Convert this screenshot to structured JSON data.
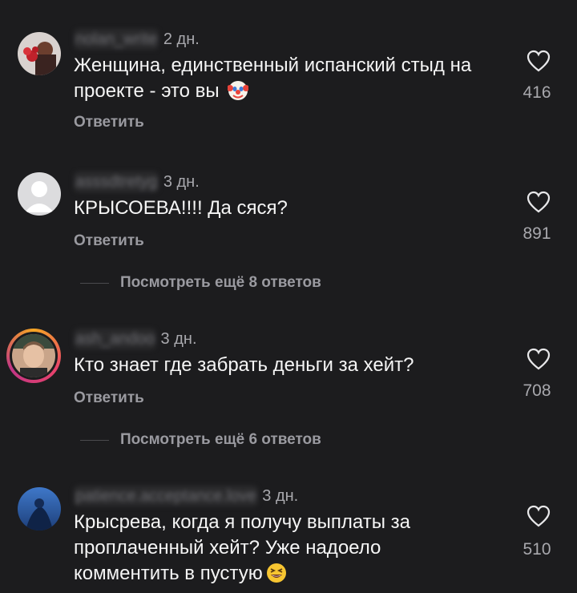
{
  "comments": [
    {
      "username": "nolan_write",
      "time": "2 дн.",
      "text": "Женщина, единственный испанский стыд на проекте - это вы",
      "emoji": "clown-face-emoji",
      "reply_label": "Ответить",
      "likes": "416"
    },
    {
      "username": "asssdtretyg",
      "time": "3 дн.",
      "text": "КРЫСОЕВА!!!! Да сяся?",
      "reply_label": "Ответить",
      "likes": "891",
      "more_replies": "Посмотреть ещё 8 ответов"
    },
    {
      "username": "ash_andoo",
      "time": "3 дн.",
      "text": "Кто знает где забрать деньги за хейт?",
      "reply_label": "Ответить",
      "likes": "708",
      "more_replies": "Посмотреть ещё 6 ответов"
    },
    {
      "username": "patience.acceptance.love",
      "time": "3 дн.",
      "text": "Крысрева, когда я получу выплаты за проплаченный хейт? Уже надоело комментить в пустую",
      "emoji": "grinning-squinting-face-emoji",
      "likes": "510"
    }
  ],
  "colors": {
    "background": "#1c1c1e",
    "text": "#f5f5f5",
    "muted": "#9a9aa0"
  }
}
